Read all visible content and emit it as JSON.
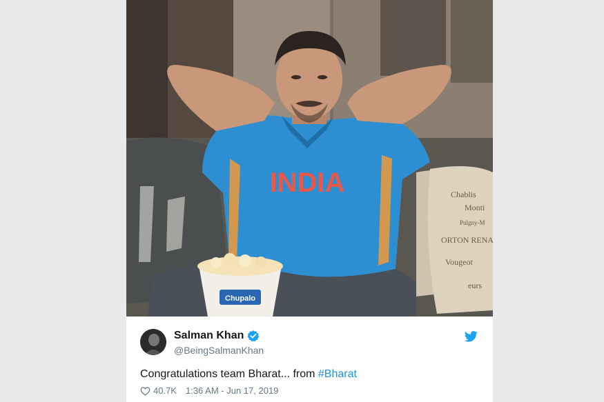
{
  "tweet": {
    "display_name": "Salman Khan",
    "handle": "@BeingSalmanKhan",
    "text_prefix": "Congratulations team Bharat... from ",
    "hashtag": "#Bharat",
    "likes": "40.7K",
    "timestamp": "1:36 AM - Jun 17, 2019",
    "verified": true
  },
  "photo": {
    "jersey_text": "INDIA",
    "popcorn_box_text": "Chupalo",
    "pillow_lines": [
      "Chablis",
      "Monti",
      "Pulgny-M",
      "ORTON RENAR",
      "Vougeot",
      "eurs"
    ]
  },
  "icons": {
    "verified": "verified-badge-icon",
    "brand": "twitter-bird-icon",
    "like": "heart-icon"
  },
  "colors": {
    "page_bg": "#e9e9e9",
    "jersey": "#2d8fd1",
    "jersey_text": "#e8584b",
    "verified_blue": "#1da1f2",
    "twitter_blue": "#1da1f2",
    "hashtag": "#1b95e0",
    "secondary_text": "#657786",
    "primary_text": "#14171a"
  }
}
